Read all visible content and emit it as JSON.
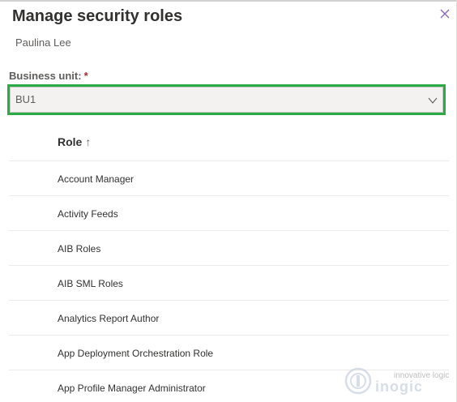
{
  "panel": {
    "title": "Manage security roles",
    "user_name": "Paulina Lee",
    "close_icon": "close-icon"
  },
  "business_unit": {
    "label": "Business unit:",
    "required_marker": "*",
    "selected": "BU1",
    "highlight_color": "#2bab46"
  },
  "roles_table": {
    "column_header": "Role",
    "sort_indicator": "↑",
    "rows": [
      "Account Manager",
      "Activity Feeds",
      "AIB Roles",
      "AIB SML Roles",
      "Analytics Report Author",
      "App Deployment Orchestration Role",
      "App Profile Manager Administrator"
    ]
  },
  "watermark": {
    "tagline": "innovative logic",
    "brand": "inogic"
  }
}
